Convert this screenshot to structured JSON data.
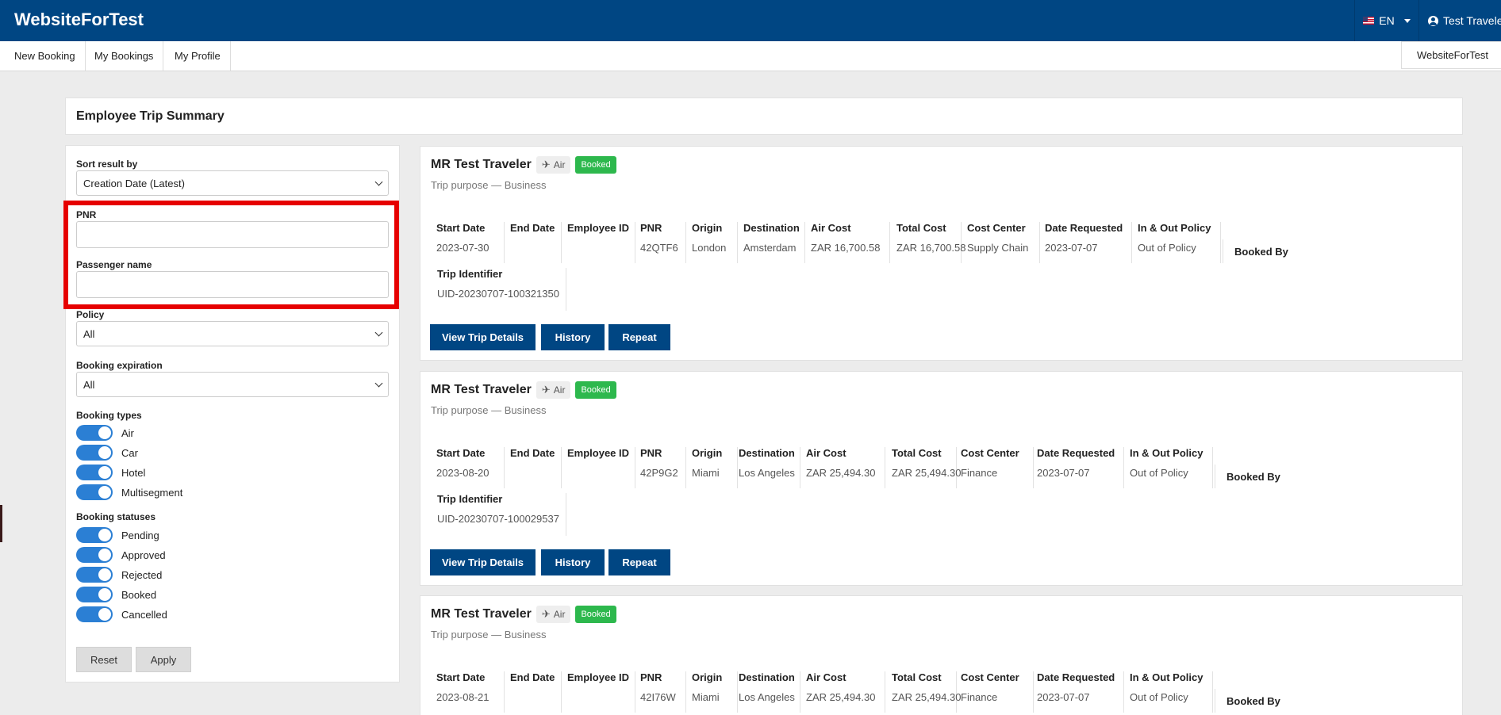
{
  "header": {
    "brand": "WebsiteForTest",
    "language": "EN",
    "user_name": "Test Traveler"
  },
  "nav": {
    "items": [
      {
        "label": "New Booking"
      },
      {
        "label": "My Bookings"
      },
      {
        "label": "My Profile"
      }
    ],
    "company": "WebsiteForTest"
  },
  "page": {
    "title": "Employee Trip Summary"
  },
  "filters": {
    "sort_label": "Sort result by",
    "sort_value": "Creation Date (Latest)",
    "pnr_label": "PNR",
    "pnr_value": "",
    "passenger_label": "Passenger name",
    "passenger_value": "",
    "policy_label": "Policy",
    "policy_value": "All",
    "expiration_label": "Booking expiration",
    "expiration_value": "All",
    "types_label": "Booking types",
    "types": [
      {
        "label": "Air",
        "on": true
      },
      {
        "label": "Car",
        "on": true
      },
      {
        "label": "Hotel",
        "on": true
      },
      {
        "label": "Multisegment",
        "on": true
      }
    ],
    "statuses_label": "Booking statuses",
    "statuses": [
      {
        "label": "Pending",
        "on": true
      },
      {
        "label": "Approved",
        "on": true
      },
      {
        "label": "Rejected",
        "on": true
      },
      {
        "label": "Booked",
        "on": true
      },
      {
        "label": "Cancelled",
        "on": true
      }
    ],
    "reset_label": "Reset",
    "apply_label": "Apply"
  },
  "columns": {
    "start_date": "Start Date",
    "end_date": "End Date",
    "employee_id": "Employee ID",
    "pnr": "PNR",
    "origin": "Origin",
    "destination": "Destination",
    "air_cost": "Air Cost",
    "total_cost": "Total Cost",
    "cost_center": "Cost Center",
    "date_requested": "Date Requested",
    "policy": "In & Out Policy",
    "booked_by": "Booked By",
    "trip_identifier": "Trip Identifier"
  },
  "actions": {
    "view": "View Trip Details",
    "history": "History",
    "repeat": "Repeat"
  },
  "colors": {
    "header_bg": "#004683",
    "booked_badge": "#2db84d",
    "toggle_on": "#2b7fd4",
    "highlight_box": "#e60000"
  },
  "trips": [
    {
      "traveler": "MR Test Traveler",
      "mode": "Air",
      "mode_icon": "plane-icon",
      "status": "Booked",
      "purpose": "Trip purpose — Business",
      "start_date": "2023-07-30",
      "end_date": "",
      "employee_id": "",
      "pnr": "42QTF6",
      "origin": "London",
      "destination": "Amsterdam",
      "air_cost": "ZAR 16,700.58",
      "total_cost": "ZAR 16,700.58",
      "cost_center": "Supply Chain",
      "date_requested": "2023-07-07",
      "policy": "Out of Policy",
      "trip_identifier": "UID-20230707-100321350"
    },
    {
      "traveler": "MR Test Traveler",
      "mode": "Air",
      "mode_icon": "plane-icon",
      "status": "Booked",
      "purpose": "Trip purpose — Business",
      "start_date": "2023-08-20",
      "end_date": "",
      "employee_id": "",
      "pnr": "42P9G2",
      "origin": "Miami",
      "destination": "Los Angeles",
      "air_cost": "ZAR 25,494.30",
      "total_cost": "ZAR 25,494.30",
      "cost_center": "Finance",
      "date_requested": "2023-07-07",
      "policy": "Out of Policy",
      "trip_identifier": "UID-20230707-100029537"
    },
    {
      "traveler": "MR Test Traveler",
      "mode": "Air",
      "mode_icon": "plane-icon",
      "status": "Booked",
      "purpose": "Trip purpose — Business",
      "start_date": "2023-08-21",
      "end_date": "",
      "employee_id": "",
      "pnr": "42I76W",
      "origin": "Miami",
      "destination": "Los Angeles",
      "air_cost": "ZAR 25,494.30",
      "total_cost": "ZAR 25,494.30",
      "cost_center": "Finance",
      "date_requested": "2023-07-07",
      "policy": "Out of Policy",
      "trip_identifier": ""
    }
  ]
}
